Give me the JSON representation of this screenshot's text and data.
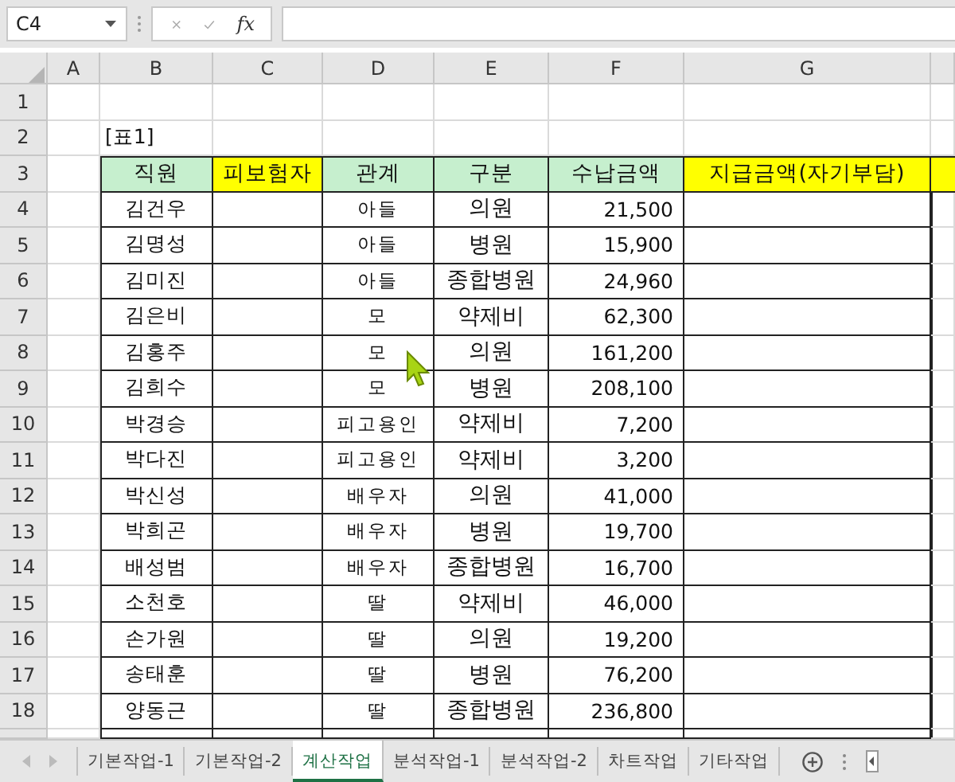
{
  "name_box": {
    "value": "C4"
  },
  "formula_bar": {
    "function_label": "fx"
  },
  "column_letters": [
    "A",
    "B",
    "C",
    "D",
    "E",
    "F",
    "G"
  ],
  "row_numbers": [
    "1",
    "2",
    "3",
    "4",
    "5",
    "6",
    "7",
    "8",
    "9",
    "10",
    "11",
    "12",
    "13",
    "14",
    "15",
    "16",
    "17",
    "18"
  ],
  "caption": "[표1]",
  "table": {
    "headers": [
      {
        "text": "직원",
        "color": "#c6efce"
      },
      {
        "text": "피보험자",
        "color": "#ffff00"
      },
      {
        "text": "관계",
        "color": "#c6efce"
      },
      {
        "text": "구분",
        "color": "#c6efce"
      },
      {
        "text": "수납금액",
        "color": "#c6efce"
      },
      {
        "text": "지급금액(자기부담)",
        "color": "#ffff00"
      },
      {
        "color": "#ffff00"
      }
    ],
    "rows": [
      {
        "employee": "김건우",
        "relation": "아들",
        "category": "의원",
        "amount": "21,500"
      },
      {
        "employee": "김명성",
        "relation": "아들",
        "category": "병원",
        "amount": "15,900"
      },
      {
        "employee": "김미진",
        "relation": "아들",
        "category": "종합병원",
        "amount": "24,960"
      },
      {
        "employee": "김은비",
        "relation": "모",
        "category": "약제비",
        "amount": "62,300"
      },
      {
        "employee": "김홍주",
        "relation": "모",
        "category": "의원",
        "amount": "161,200"
      },
      {
        "employee": "김희수",
        "relation": "모",
        "category": "병원",
        "amount": "208,100"
      },
      {
        "employee": "박경승",
        "relation": "피고용인",
        "category": "약제비",
        "amount": "7,200"
      },
      {
        "employee": "박다진",
        "relation": "피고용인",
        "category": "약제비",
        "amount": "3,200"
      },
      {
        "employee": "박신성",
        "relation": "배우자",
        "category": "의원",
        "amount": "41,000"
      },
      {
        "employee": "박희곤",
        "relation": "배우자",
        "category": "병원",
        "amount": "19,700"
      },
      {
        "employee": "배성범",
        "relation": "배우자",
        "category": "종합병원",
        "amount": "16,700"
      },
      {
        "employee": "소천호",
        "relation": "딸",
        "category": "약제비",
        "amount": "46,000"
      },
      {
        "employee": "손가원",
        "relation": "딸",
        "category": "의원",
        "amount": "19,200"
      },
      {
        "employee": "송태훈",
        "relation": "딸",
        "category": "병원",
        "amount": "76,200"
      },
      {
        "employee": "양동근",
        "relation": "딸",
        "category": "종합병원",
        "amount": "236,800"
      }
    ]
  },
  "sheet_tabs": [
    {
      "label": "기본작업-1",
      "selected": false
    },
    {
      "label": "기본작업-2",
      "selected": false
    },
    {
      "label": "계산작업",
      "selected": true
    },
    {
      "label": "분석작업-1",
      "selected": false
    },
    {
      "label": "분석작업-2",
      "selected": false
    },
    {
      "label": "차트작업",
      "selected": false
    },
    {
      "label": "기타작업",
      "selected": false
    }
  ]
}
